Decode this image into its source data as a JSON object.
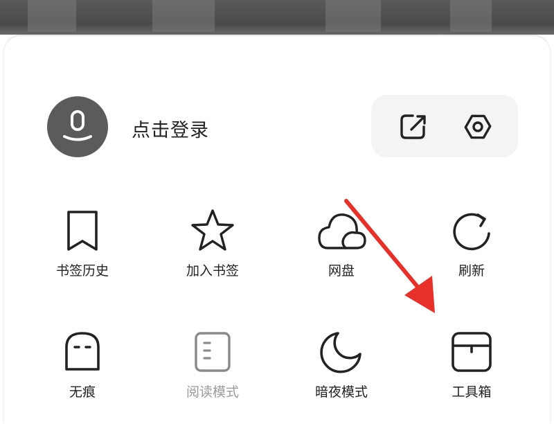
{
  "account": {
    "login_label": "点击登录"
  },
  "icons": {
    "avatar": "user-avatar-icon",
    "share": "share-icon",
    "settings": "settings-hexagon-icon"
  },
  "menu": {
    "row1": [
      {
        "label": "书签历史",
        "icon": "bookmark-icon"
      },
      {
        "label": "加入书签",
        "icon": "star-icon"
      },
      {
        "label": "网盘",
        "icon": "cloud-icon"
      },
      {
        "label": "刷新",
        "icon": "refresh-icon"
      }
    ],
    "row2": [
      {
        "label": "无痕",
        "icon": "incognito-icon",
        "enabled": true
      },
      {
        "label": "阅读模式",
        "icon": "reading-mode-icon",
        "enabled": false
      },
      {
        "label": "暗夜模式",
        "icon": "moon-icon",
        "enabled": true
      },
      {
        "label": "工具箱",
        "icon": "toolbox-icon",
        "enabled": true
      }
    ]
  },
  "colors": {
    "annotation_arrow": "#e8302a",
    "text": "#222222",
    "disabled_text": "#9b9b9b",
    "avatar_bg": "#5b5b5b"
  }
}
